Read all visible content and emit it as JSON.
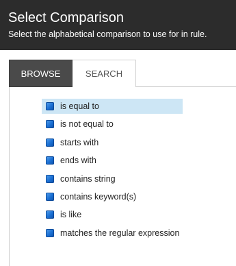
{
  "header": {
    "title": "Select Comparison",
    "subtitle": "Select the alphabetical comparison to use for in rule."
  },
  "tabs": [
    {
      "label": "BROWSE",
      "active": true
    },
    {
      "label": "SEARCH",
      "active": false
    }
  ],
  "options": [
    {
      "label": "is equal to",
      "selected": true,
      "icon": "blue-square-icon"
    },
    {
      "label": "is not equal to",
      "selected": false,
      "icon": "blue-square-icon"
    },
    {
      "label": "starts with",
      "selected": false,
      "icon": "blue-square-icon"
    },
    {
      "label": "ends with",
      "selected": false,
      "icon": "blue-square-icon"
    },
    {
      "label": "contains string",
      "selected": false,
      "icon": "blue-square-icon"
    },
    {
      "label": "contains keyword(s)",
      "selected": false,
      "icon": "blue-square-icon"
    },
    {
      "label": "is like",
      "selected": false,
      "icon": "blue-square-icon"
    },
    {
      "label": "matches the regular expression",
      "selected": false,
      "icon": "blue-square-icon"
    }
  ],
  "colors": {
    "header_bg": "#2c2c2c",
    "active_tab_bg": "#4a4a4a",
    "selected_item_bg": "#cde6f5",
    "icon_blue": "#1a6fd3"
  }
}
